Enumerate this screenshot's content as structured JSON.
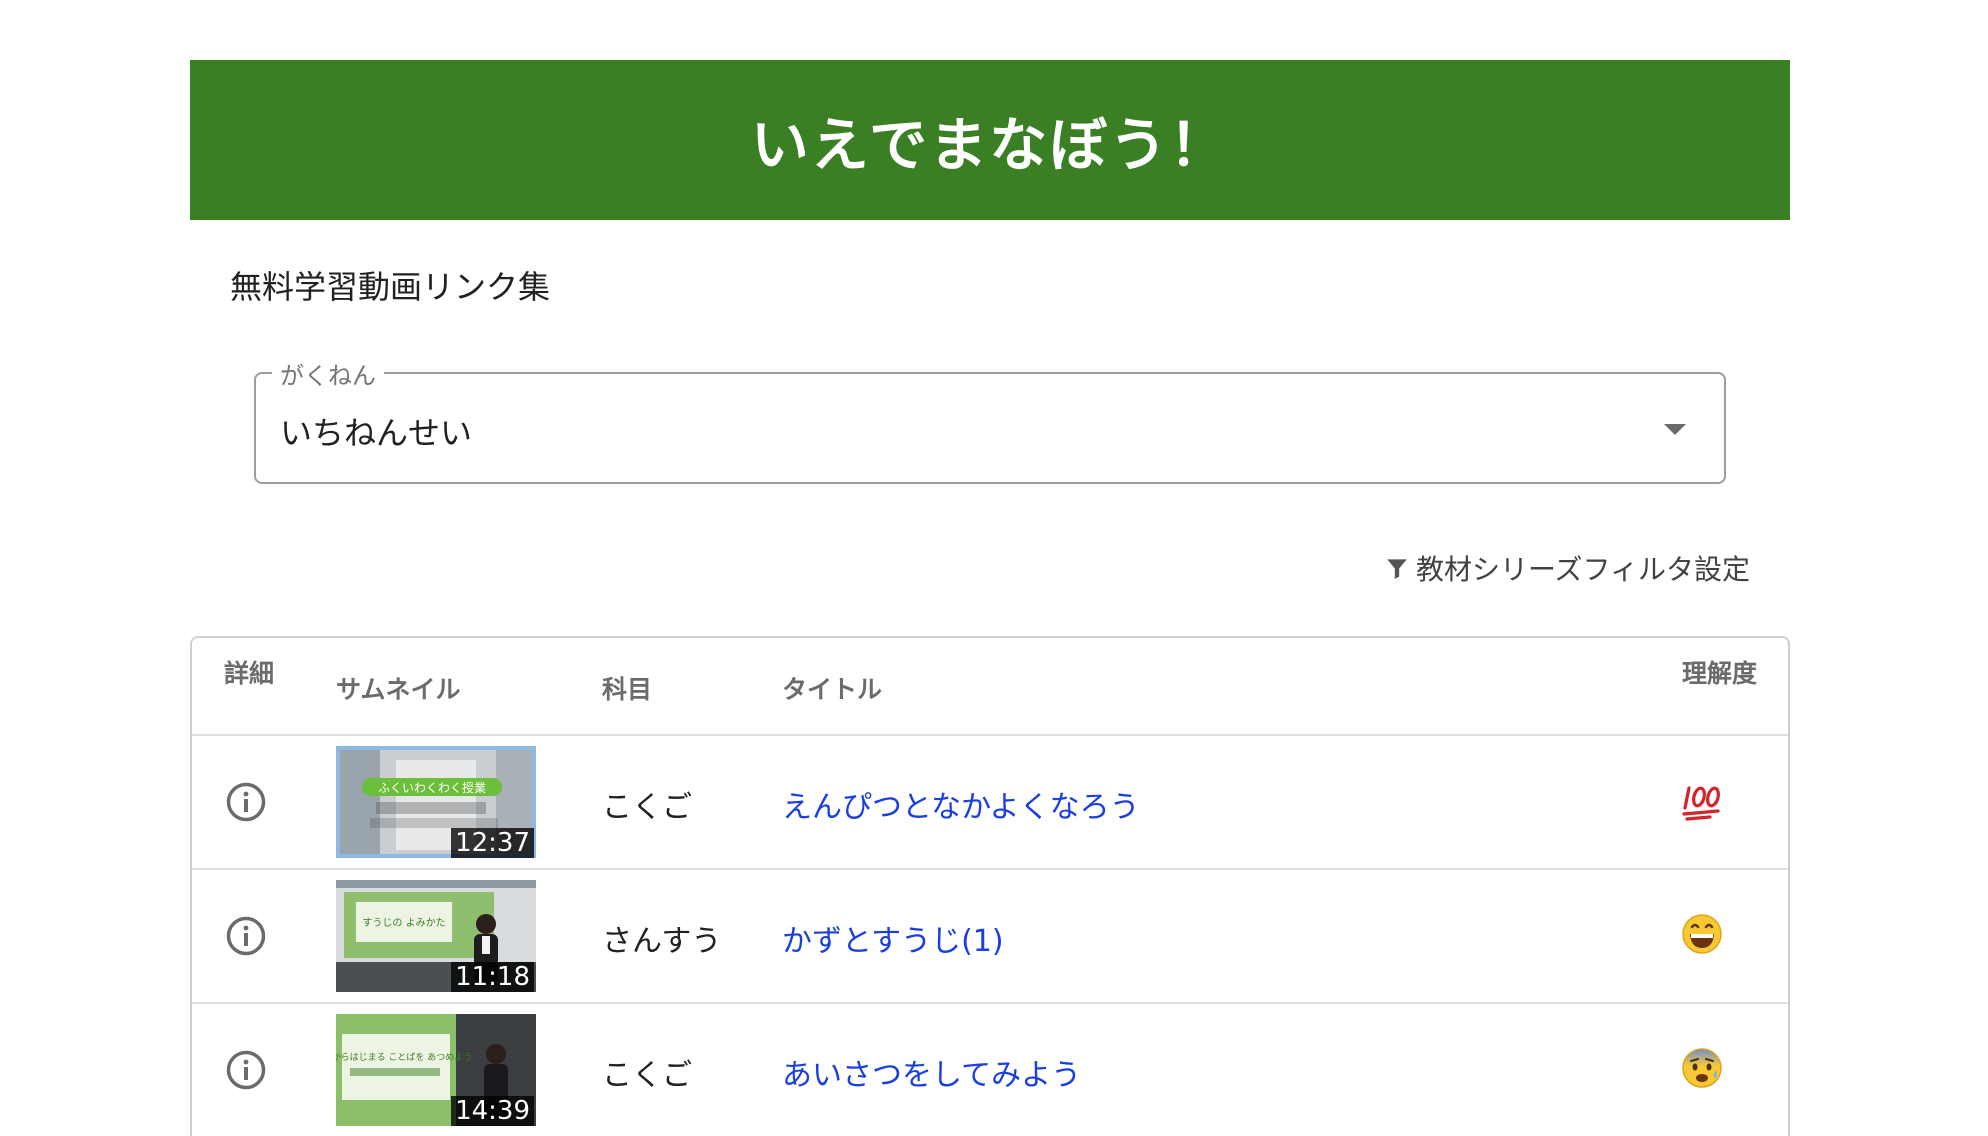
{
  "header": {
    "title": "いえでまなぼう！",
    "bg_color": "#3a7f23"
  },
  "subtitle": "無料学習動画リンク集",
  "grade_select": {
    "label": "がくねん",
    "value": "いちねんせい",
    "icon": "chevron-down-icon"
  },
  "filter": {
    "label": "教材シリーズフィルタ設定",
    "icon": "filter-icon"
  },
  "table": {
    "headers": {
      "detail": "詳細",
      "thumbnail": "サムネイル",
      "subject": "科目",
      "title": "タイトル",
      "understanding": "理解度"
    },
    "rows": [
      {
        "subject": "こくご",
        "title": "えんぴつとなかよくなろう",
        "duration": "12:37",
        "understanding": "hundred-points-icon",
        "thumb_text": "ふくいわくわく授業"
      },
      {
        "subject": "さんすう",
        "title": "かずとすうじ(1)",
        "duration": "11:18",
        "understanding": "grinning-face-icon",
        "thumb_text": "すうじの よみかた"
      },
      {
        "subject": "こくご",
        "title": "あいさつをしてみよう",
        "duration": "14:39",
        "understanding": "anxious-face-icon",
        "thumb_text": "あ からはじまる ことばを あつめよう"
      }
    ]
  },
  "colors": {
    "link": "#1a3fe0",
    "border": "#cfcfcf",
    "header_text": "#6b6b6b"
  }
}
